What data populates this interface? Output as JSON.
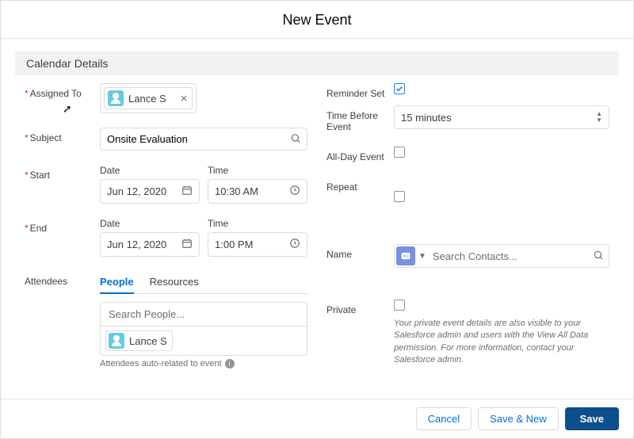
{
  "modal": {
    "title": "New Event"
  },
  "section": {
    "calendar_details": "Calendar Details"
  },
  "left": {
    "assigned_to": {
      "label": "Assigned To",
      "pill": "Lance S"
    },
    "subject": {
      "label": "Subject",
      "value": "Onsite Evaluation"
    },
    "start": {
      "label": "Start",
      "date_label": "Date",
      "date_value": "Jun 12, 2020",
      "time_label": "Time",
      "time_value": "10:30 AM"
    },
    "end": {
      "label": "End",
      "date_label": "Date",
      "date_value": "Jun 12, 2020",
      "time_label": "Time",
      "time_value": "1:00 PM"
    },
    "attendees": {
      "label": "Attendees",
      "tab_people": "People",
      "tab_resources": "Resources",
      "search_placeholder": "Search People...",
      "item": "Lance S",
      "helper": "Attendees auto-related to event"
    }
  },
  "right": {
    "reminder": {
      "label": "Reminder Set",
      "checked": true
    },
    "time_before": {
      "label": "Time Before Event",
      "value": "15 minutes"
    },
    "all_day": {
      "label": "All-Day Event"
    },
    "repeat": {
      "label": "Repeat"
    },
    "name": {
      "label": "Name",
      "placeholder": "Search Contacts..."
    },
    "private": {
      "label": "Private",
      "hint": "Your private event details are also visible to your Salesforce admin and users with the View All Data permission. For more information, contact your Salesforce admin."
    }
  },
  "footer": {
    "cancel": "Cancel",
    "save_new": "Save & New",
    "save": "Save"
  }
}
